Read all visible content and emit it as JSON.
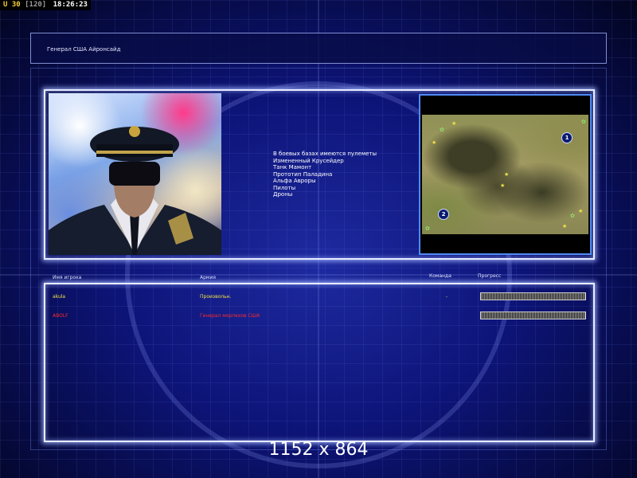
{
  "overlay": {
    "fps_current": "30",
    "fps_max": "[120]",
    "clock": "18:26:23",
    "resolution": "1152 x 864"
  },
  "loading_screen": {
    "title": "Генерал США Айронсайд",
    "intel_lines": [
      "В боевых базах имеются пулеметы",
      "Измененный Крусейдер",
      "Танк Мамонт",
      "Прототип Паладина",
      "Альфа Авроры",
      "Пилоты",
      "Дроны"
    ],
    "columns": {
      "player": "Имя игрока",
      "army": "Армия",
      "team": "Команда",
      "progress": "Прогресс"
    },
    "players": [
      {
        "name": "akula",
        "army": "Произвольн.",
        "team": "-",
        "progress": 1.0,
        "color": "#f0e040"
      },
      {
        "name": "ABOLF",
        "army": "Генерал морпехов США",
        "team": "",
        "progress": 1.0,
        "color": "#ff2a2a"
      }
    ],
    "minimap": {
      "spawn_labels": [
        "1",
        "2"
      ]
    },
    "colors": {
      "accent": "#4f8af5",
      "panel_border": "#e8ecff"
    }
  }
}
